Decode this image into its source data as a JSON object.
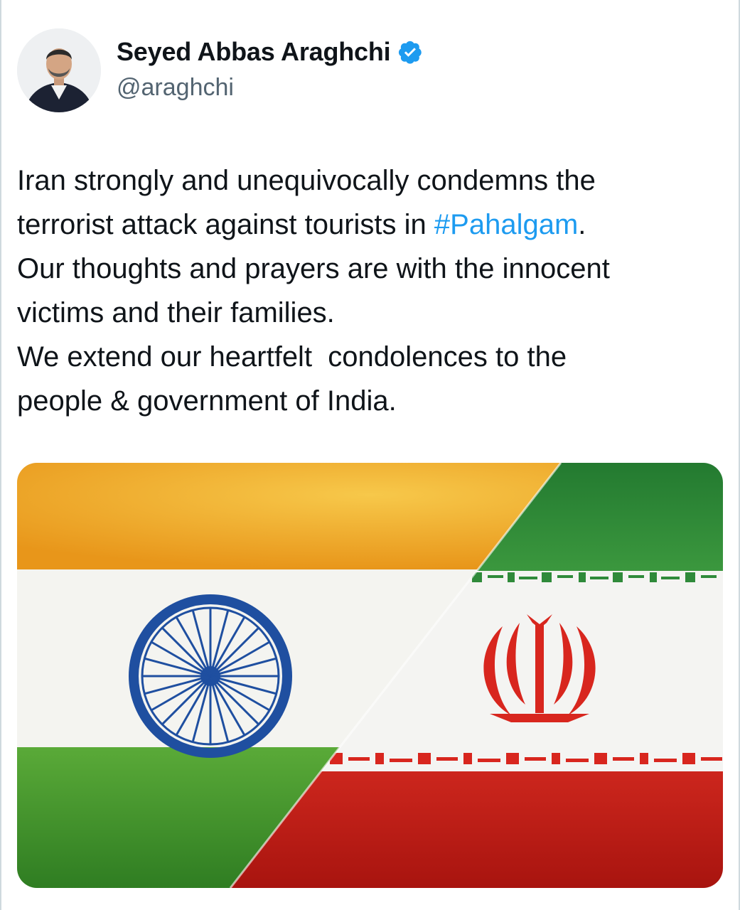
{
  "author": {
    "display_name": "Seyed Abbas Araghchi",
    "handle": "@araghchi",
    "verified": true
  },
  "tweet": {
    "line1": "Iran strongly and unequivocally condemns the",
    "line2_prefix": "terrorist attack against tourists in ",
    "hashtag": "#Pahalgam",
    "line2_suffix": ".",
    "line3": "Our thoughts and prayers are with the innocent",
    "line4": "victims and their families.",
    "line5": "We extend our heartfelt  condolences to the",
    "line6": "people & government of India."
  },
  "media": {
    "description_icon": "india-iran-flag-image",
    "colors": {
      "saffron": "#f0a020",
      "white": "#f4f4f2",
      "india_green": "#3f9a2e",
      "chakra_blue": "#1f4fa0",
      "iran_green": "#2f8a3a",
      "iran_red": "#d8261e"
    }
  },
  "colors": {
    "text": "#0f1419",
    "secondary": "#536471",
    "link": "#1d9bf0",
    "verified": "#1d9bf0"
  }
}
